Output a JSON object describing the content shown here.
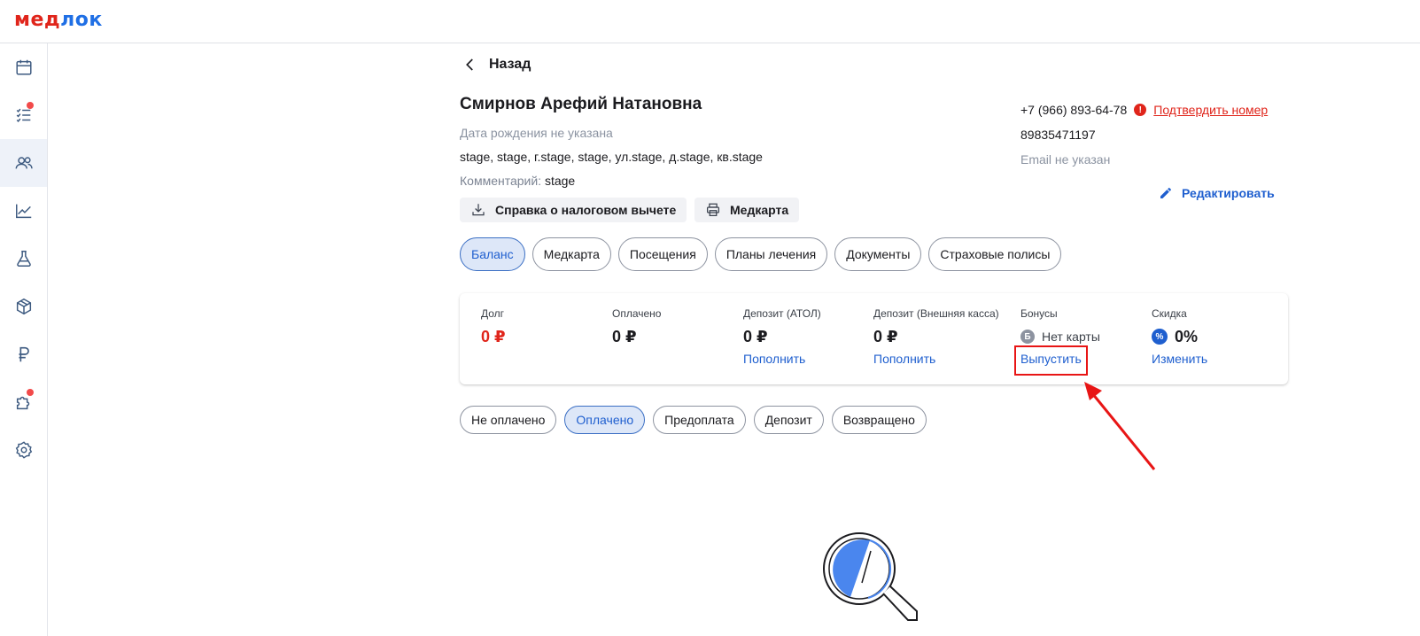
{
  "brand": {
    "logo_part1": "мед",
    "logo_part2": "лок"
  },
  "sidebar": {
    "items": [
      {
        "icon": "calendar-icon",
        "active": false,
        "badge": false
      },
      {
        "icon": "checklist-icon",
        "active": false,
        "badge": true
      },
      {
        "icon": "users-icon",
        "active": true,
        "badge": false
      },
      {
        "icon": "chart-icon",
        "active": false,
        "badge": false
      },
      {
        "icon": "flask-icon",
        "active": false,
        "badge": false
      },
      {
        "icon": "box-icon",
        "active": false,
        "badge": false
      },
      {
        "icon": "ruble-icon",
        "active": false,
        "badge": false
      },
      {
        "icon": "puzzle-icon",
        "active": false,
        "badge": true
      },
      {
        "icon": "gear-icon",
        "active": false,
        "badge": false
      }
    ]
  },
  "back": {
    "label": "Назад"
  },
  "patient": {
    "name": "Смирнов Арефий Натановна",
    "birth": "Дата рождения не указана",
    "address": "stage, stage, г.stage, stage, ул.stage, д.stage, кв.stage",
    "comment_label": "Комментарий:",
    "comment_value": "stage",
    "tax_button": "Справка о налоговом вычете",
    "medcard_button": "Медкарта"
  },
  "contacts": {
    "phone": "+7 (966) 893-64-78",
    "confirm_label": "Подтвердить номер",
    "phone2": "89835471197",
    "email": "Email не указан",
    "edit_label": "Редактировать"
  },
  "tabs": [
    "Баланс",
    "Медкарта",
    "Посещения",
    "Планы лечения",
    "Документы",
    "Страховые полисы"
  ],
  "active_tab": 0,
  "balance": {
    "debt": {
      "label": "Долг",
      "value": "0 ₽"
    },
    "paid": {
      "label": "Оплачено",
      "value": "0 ₽"
    },
    "deposit_atol": {
      "label": "Депозит (АТОЛ)",
      "value": "0 ₽",
      "link": "Пополнить"
    },
    "deposit_ext": {
      "label": "Депозит (Внешняя касса)",
      "value": "0 ₽",
      "link": "Пополнить"
    },
    "bonuses": {
      "label": "Бонусы",
      "icon_letter": "Б",
      "value": "Нет карты",
      "link": "Выпустить"
    },
    "discount": {
      "label": "Скидка",
      "icon_letter": "%",
      "value": "0%",
      "link": "Изменить"
    }
  },
  "filters": [
    "Не оплачено",
    "Оплачено",
    "Предоплата",
    "Депозит",
    "Возвращено"
  ],
  "active_filter": 1,
  "colors": {
    "accent": "#1f5fcf",
    "danger": "#e0251b",
    "annotation": "#e81515"
  }
}
